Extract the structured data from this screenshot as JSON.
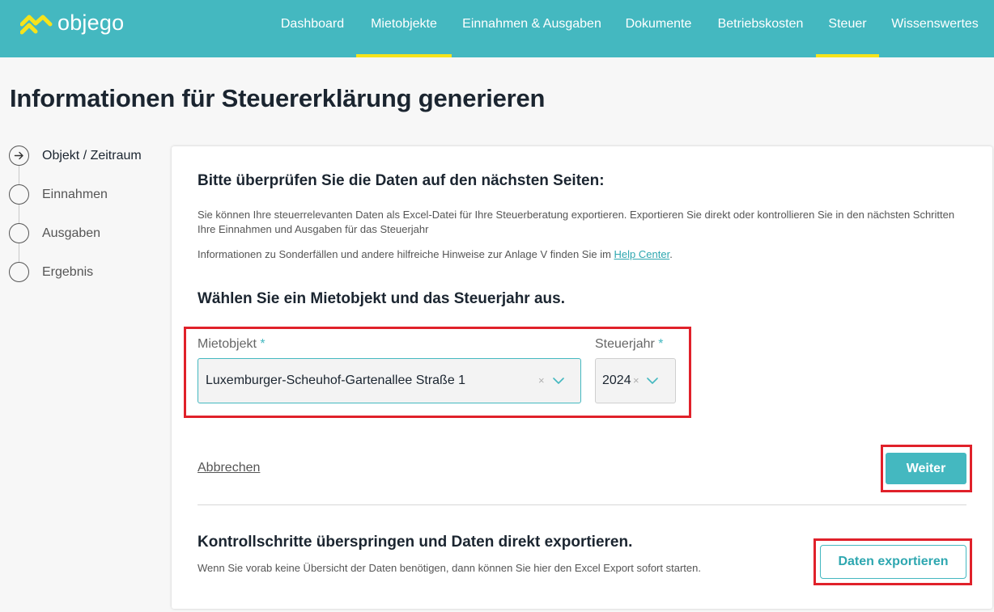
{
  "brand": {
    "name": "objego",
    "logo_color": "#f6e31b"
  },
  "nav": {
    "items": [
      {
        "label": "Dashboard",
        "active": false
      },
      {
        "label": "Mietobjekte",
        "active": true
      },
      {
        "label": "Einnahmen & Ausgaben",
        "active": false
      },
      {
        "label": "Dokumente",
        "active": false
      },
      {
        "label": "Betriebskosten",
        "active": false
      },
      {
        "label": "Steuer",
        "active": true
      },
      {
        "label": "Wissenswertes",
        "active": false
      }
    ]
  },
  "page": {
    "title": "Informationen für Steuererklärung generieren"
  },
  "stepper": {
    "steps": [
      {
        "label": "Objekt / Zeitraum",
        "icon": "arrow-right-circle-icon",
        "active": true
      },
      {
        "label": "Einnahmen",
        "active": false
      },
      {
        "label": "Ausgaben",
        "active": false
      },
      {
        "label": "Ergebnis",
        "active": false
      }
    ]
  },
  "card": {
    "review_heading": "Bitte überprüfen Sie die Daten auf den nächsten Seiten:",
    "review_text": "Sie können Ihre steuerrelevanten Daten als Excel-Datei für Ihre Steuerberatung exportieren. Exportieren Sie direkt oder kontrollieren Sie in den nächsten Schritten Ihre Einnahmen und Ausgaben für das Steuerjahr",
    "info_prefix": "Informationen zu Sonderfällen und andere hilfreiche Hinweise zur Anlage V finden Sie im ",
    "info_link": "Help Center",
    "info_suffix": ".",
    "select_heading": "Wählen Sie ein Mietobjekt und das Steuerjahr aus.",
    "property": {
      "label": "Mietobjekt",
      "required_mark": "*",
      "value": "Luxemburger-Scheuhof-Gartenallee Straße 1"
    },
    "year": {
      "label": "Steuerjahr",
      "required_mark": "*",
      "value": "2024"
    },
    "cancel_label": "Abbrechen",
    "next_label": "Weiter",
    "skip_heading": "Kontrollschritte überspringen und Daten direkt exportieren.",
    "skip_text": "Wenn Sie vorab keine Übersicht der Daten benötigen, dann können Sie hier den Excel Export sofort starten.",
    "export_label": "Daten exportieren"
  },
  "colors": {
    "accent": "#44b8c0",
    "highlight": "#e0212a",
    "underline": "#f6e31b"
  }
}
